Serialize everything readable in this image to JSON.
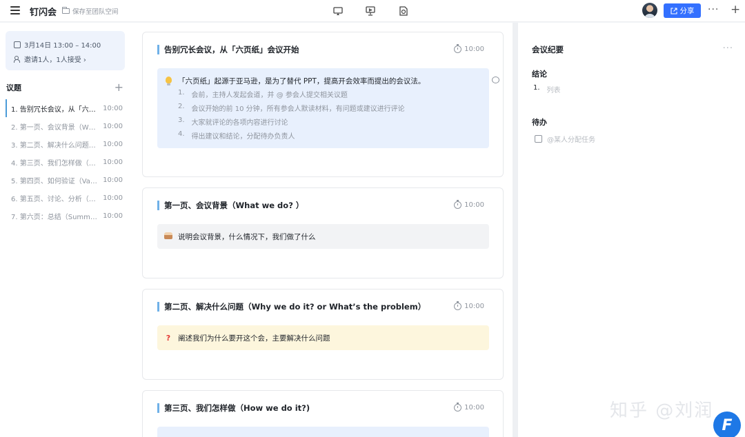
{
  "header": {
    "app_title": "钉闪会",
    "space_label": "保存至团队空间",
    "share_label": "分享"
  },
  "sidebar": {
    "info": {
      "datetime": "3月14日 13:00 – 14:00",
      "invite": "邀请1人，1人接受 ›"
    },
    "agenda_title": "议题",
    "items": [
      {
        "label": "1. 告别冗长会议，从「六…",
        "time": "10:00"
      },
      {
        "label": "2. 第一页、会议背景（W…",
        "time": "10:00"
      },
      {
        "label": "3. 第二页、解决什么问题…",
        "time": "10:00"
      },
      {
        "label": "4. 第三页、我们怎样做（…",
        "time": "10:00"
      },
      {
        "label": "5. 第四页、如何验证（Va…",
        "time": "10:00"
      },
      {
        "label": "6. 第五页、讨论、分析（…",
        "time": "10:00"
      },
      {
        "label": "7. 第六页：总结（Summ…",
        "time": "10:00"
      }
    ]
  },
  "cards": [
    {
      "title": "告别冗长会议，从「六页纸」会议开始",
      "time": "10:00",
      "callout": "「六页纸」起源于亚马逊，是为了替代 PPT，提高开会效率而提出的会议法。",
      "steps": [
        {
          "n": "1.",
          "text": "会前，主持人发起会道，并 @ 参会人提交相关议题"
        },
        {
          "n": "2.",
          "text": "会议开始的前 10 分钟，所有参会人默读材料，有问题或建议进行评论"
        },
        {
          "n": "3.",
          "text": "大家就评论的各项内容进行讨论"
        },
        {
          "n": "4.",
          "text": "得出建议和结论，分配待办负责人"
        }
      ]
    },
    {
      "title": "第一页、会议背景（What we do? ）",
      "time": "10:00",
      "callout": "说明会议背景，什么情况下，我们做了什么"
    },
    {
      "title": "第二页、解决什么问题（Why we do it? or What’s the problem）",
      "time": "10:00",
      "callout": "阐述我们为什么要开这个会，主要解决什么问题"
    },
    {
      "title": "第三页、我们怎样做（How we do it?)",
      "time": "10:00"
    }
  ],
  "right": {
    "title": "会议纪要",
    "conclusion_heading": "结论",
    "list_number": "1.",
    "list_placeholder": "列表",
    "todo_heading": "待办",
    "todo_placeholder": "@某人分配任务"
  },
  "watermark": "知乎 @刘润",
  "badge": "F"
}
